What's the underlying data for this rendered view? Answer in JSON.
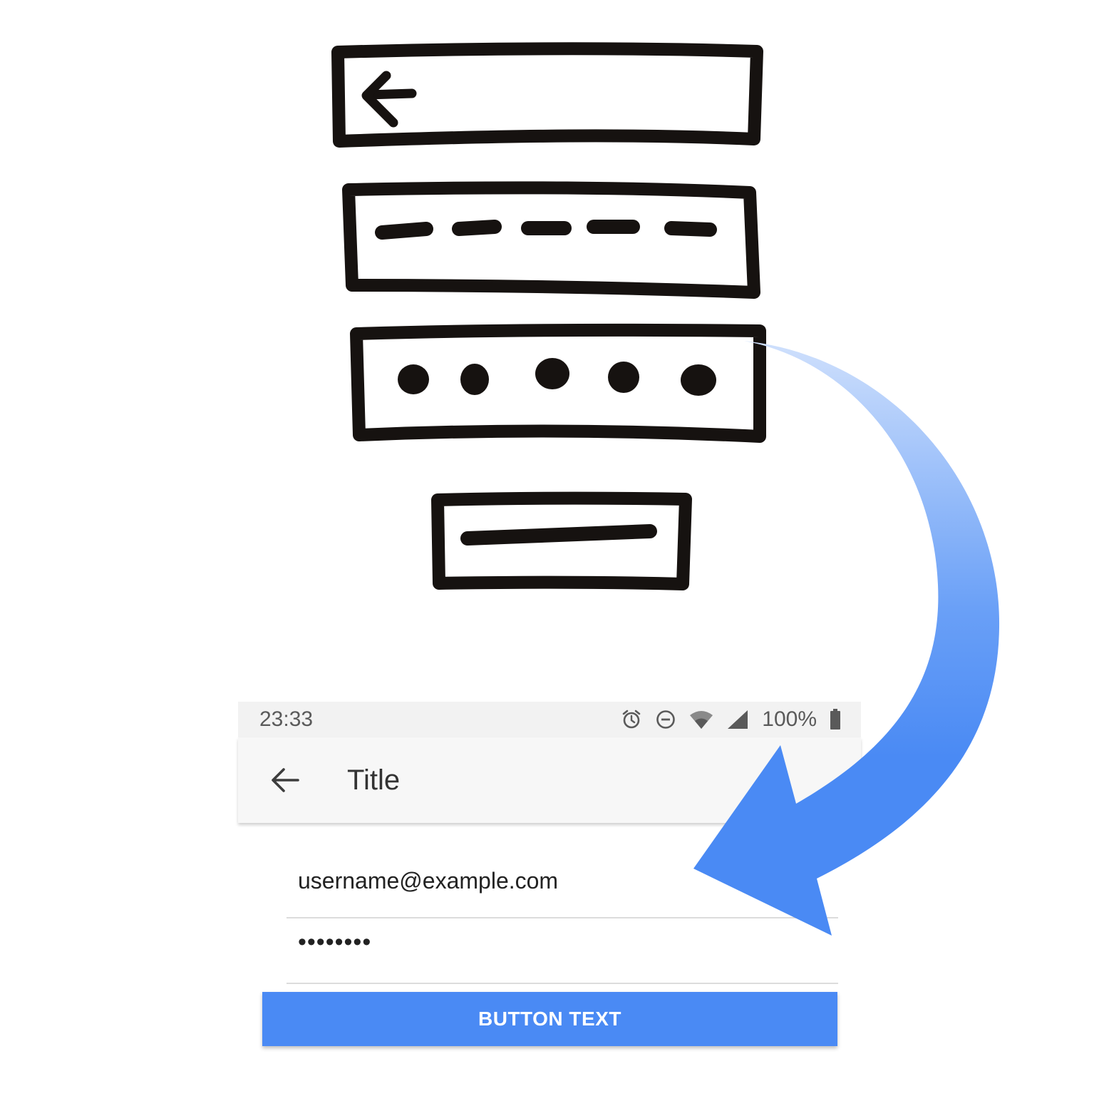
{
  "status_bar": {
    "time": "23:33",
    "icons": [
      "alarm-icon",
      "do-not-disturb-icon",
      "wifi-icon",
      "cell-signal-icon",
      "battery-icon"
    ],
    "battery_percent": "100%"
  },
  "app_bar": {
    "back_icon": "arrow-back-icon",
    "title": "Title"
  },
  "form": {
    "email_value": "username@example.com",
    "password_value": "••••••••",
    "button_label": "BUTTON TEXT"
  },
  "colors": {
    "accent": "#4a8af4",
    "sketch_ink": "#161210",
    "arrow_light": "#cfe0fc",
    "arrow_dark": "#4a8af4"
  }
}
